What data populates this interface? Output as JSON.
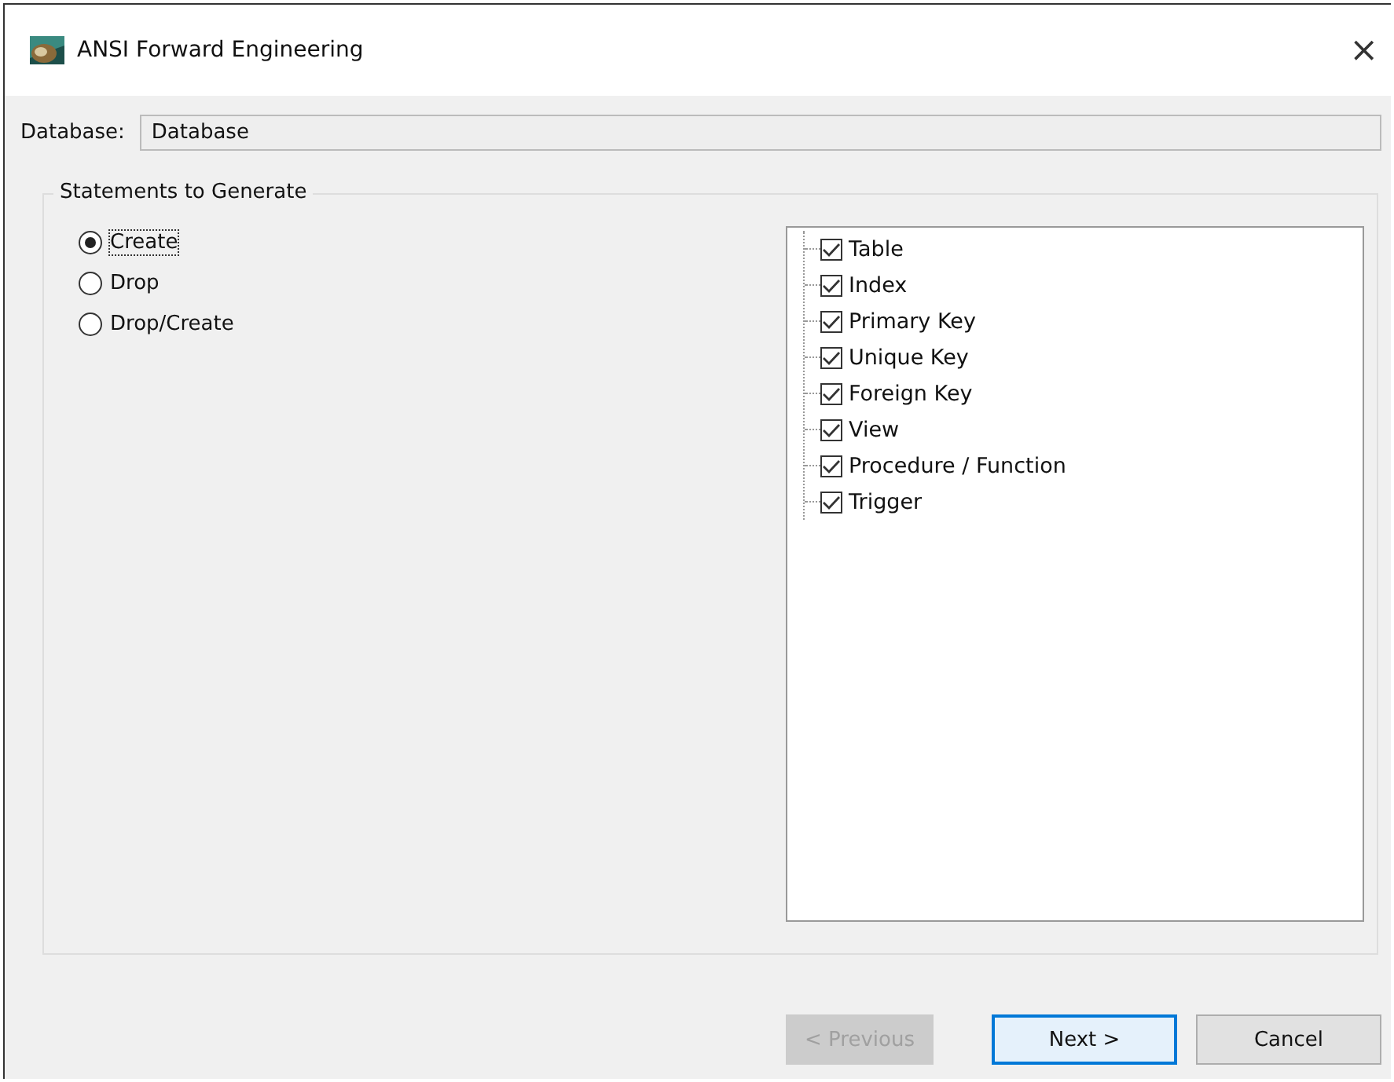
{
  "window": {
    "title": "ANSI Forward Engineering",
    "close": "×"
  },
  "database": {
    "label": "Database:",
    "value": "Database"
  },
  "statements": {
    "title": "Statements to Generate",
    "options": [
      {
        "label": "Create",
        "selected": true
      },
      {
        "label": "Drop",
        "selected": false
      },
      {
        "label": "Drop/Create",
        "selected": false
      }
    ],
    "objects": [
      {
        "label": "Table",
        "checked": true
      },
      {
        "label": "Index",
        "checked": true
      },
      {
        "label": "Primary Key",
        "checked": true
      },
      {
        "label": "Unique Key",
        "checked": true
      },
      {
        "label": "Foreign Key",
        "checked": true
      },
      {
        "label": "View",
        "checked": true
      },
      {
        "label": "Procedure / Function",
        "checked": true
      },
      {
        "label": "Trigger",
        "checked": true
      }
    ]
  },
  "buttons": [
    {
      "label": "< Previous",
      "disabled": true,
      "default": false
    },
    {
      "label": "Next >",
      "disabled": false,
      "default": true
    },
    {
      "label": "Cancel",
      "disabled": false,
      "default": false
    }
  ]
}
